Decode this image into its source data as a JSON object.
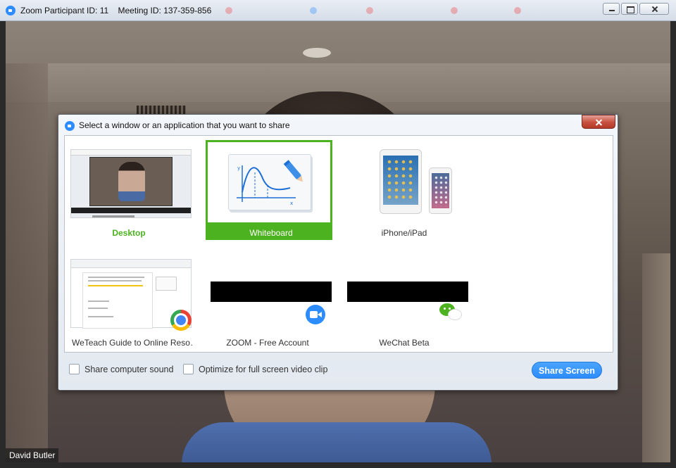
{
  "window": {
    "title_participant": "Zoom Participant ID: 11",
    "title_meeting": "Meeting ID: 137-359-856"
  },
  "video": {
    "participant_name": "David Butler"
  },
  "share_dialog": {
    "title": "Select a window or an application that you want to share",
    "tiles": [
      {
        "label": "Desktop",
        "icon": "desktop-preview"
      },
      {
        "label": "Whiteboard",
        "icon": "whiteboard-icon",
        "selected": true
      },
      {
        "label": "iPhone/iPad",
        "icon": "ios-devices-icon"
      },
      {
        "label": "WeTeach Guide to Online Reso…",
        "icon": "chrome-icon"
      },
      {
        "label": "ZOOM - Free Account",
        "icon": "zoom-icon"
      },
      {
        "label": "WeChat Beta",
        "icon": "wechat-icon"
      }
    ],
    "options": {
      "share_sound": "Share computer sound",
      "optimize_video": "Optimize for full screen video clip"
    },
    "share_button": "Share Screen"
  },
  "colors": {
    "zoom_blue": "#2d8cff",
    "selected_green": "#4db21f",
    "close_red": "#c8503e"
  }
}
